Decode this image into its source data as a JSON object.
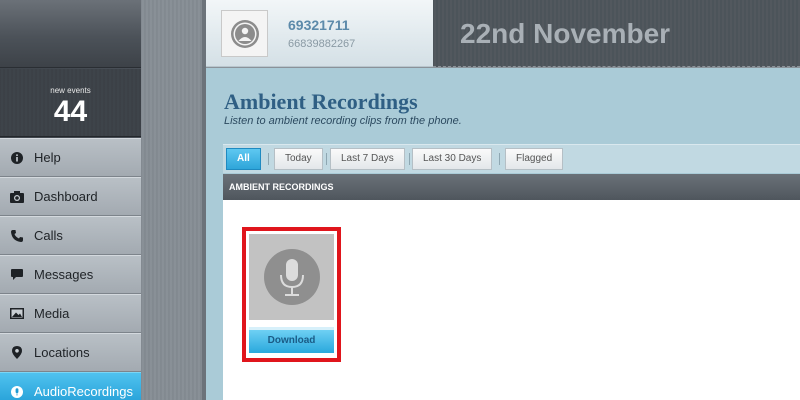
{
  "events": {
    "label": "new events",
    "count": "44"
  },
  "nav": {
    "items": [
      {
        "label": "Help",
        "icon": "info-icon",
        "active": false
      },
      {
        "label": "Dashboard",
        "icon": "camera-icon",
        "active": false
      },
      {
        "label": "Calls",
        "icon": "phone-icon",
        "active": false
      },
      {
        "label": "Messages",
        "icon": "message-icon",
        "active": false
      },
      {
        "label": "Media",
        "icon": "image-icon",
        "active": false
      },
      {
        "label": "Locations",
        "icon": "location-pin-icon",
        "active": false
      },
      {
        "label": "AudioRecordings",
        "icon": "microphone-icon",
        "active": true
      }
    ]
  },
  "profile": {
    "id": "69321711",
    "phone": "66839882267"
  },
  "header": {
    "date": "22nd November"
  },
  "page": {
    "title": "Ambient Recordings",
    "subtitle": "Listen to ambient recording clips from the phone."
  },
  "filters": {
    "all": "All",
    "today": "Today",
    "last7": "Last 7 Days",
    "last30": "Last 30 Days",
    "flagged": "Flagged",
    "selected": "All"
  },
  "section": {
    "title": "AMBIENT RECORDINGS"
  },
  "recordings": [
    {
      "icon": "microphone-icon",
      "download_label": "Download",
      "highlight_color": "#e0151c"
    }
  ],
  "colors": {
    "accent": "#2ea5d9",
    "title": "#2f5f84",
    "highlight": "#e0151c"
  }
}
